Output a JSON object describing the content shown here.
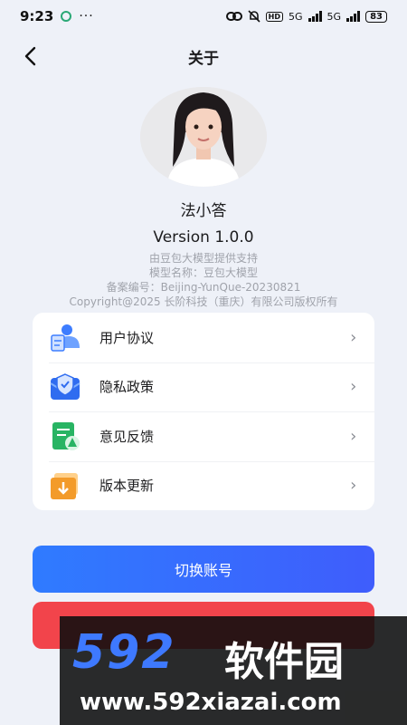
{
  "status_bar": {
    "time": "9:23",
    "dots": "···",
    "network_label": "5G",
    "network_label_2": "5G",
    "hd_label": "HD",
    "battery": "83"
  },
  "nav": {
    "title": "关于",
    "back_icon": "chevron-left-icon"
  },
  "profile": {
    "app_name": "法小答",
    "version": "Version 1.0.0",
    "lines": [
      "由豆包大模型提供支持",
      "模型名称：豆包大模型",
      "备案编号：Beijing-YunQue-20230821",
      "Copyright@2025 长阶科技（重庆）有限公司版权所有"
    ]
  },
  "menu": {
    "items": [
      {
        "label": "用户协议",
        "icon": "user-agreement-icon"
      },
      {
        "label": "隐私政策",
        "icon": "privacy-shield-icon"
      },
      {
        "label": "意见反馈",
        "icon": "feedback-icon"
      },
      {
        "label": "版本更新",
        "icon": "download-update-icon"
      }
    ],
    "chevron": "›"
  },
  "buttons": {
    "switch_account": "切换账号"
  },
  "watermark": {
    "logo": "592",
    "brand": "软件园",
    "url": "www.592xiazai.com"
  },
  "colors": {
    "accent_blue": "#2f7bff",
    "danger_red": "#f2444b",
    "background": "#eef1f8"
  }
}
